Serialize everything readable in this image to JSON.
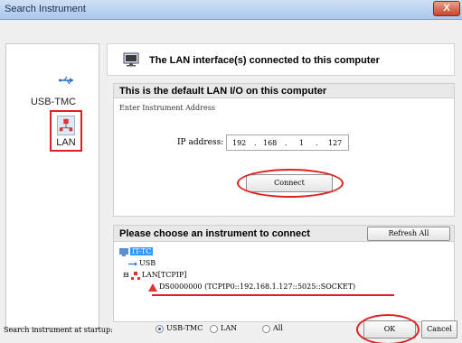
{
  "window": {
    "title": "Search Instrument",
    "close_glyph": "X"
  },
  "sidebar": {
    "items": [
      {
        "label": "USB-TMC",
        "icon": "usb-icon",
        "selected": false
      },
      {
        "label": "LAN",
        "icon": "lan-icon",
        "selected": true
      }
    ]
  },
  "header": {
    "text": "The LAN interface(s) connected to this computer",
    "icon": "monitor-icon"
  },
  "lan_panel": {
    "title": "This is the default LAN I/O on this computer",
    "subtitle": "Enter Instrument Address",
    "ip_label": "IP address:",
    "ip": [
      "192",
      "168",
      "1",
      "127"
    ],
    "connect_label": "Connect"
  },
  "list_panel": {
    "title": "Please choose an instrument to connect",
    "refresh_label": "Refresh All",
    "tree": {
      "root": "IT-TC",
      "usb": "USB",
      "lan": "LAN[TCPIP]",
      "instrument": "DS0000000  (TCPIP0::192.168.1.127::5025::SOCKET)"
    }
  },
  "footer": {
    "startup_label": "Search instrument at startup:",
    "options": [
      {
        "label": "USB-TMC",
        "checked": true
      },
      {
        "label": "LAN",
        "checked": false
      },
      {
        "label": "All",
        "checked": false
      }
    ],
    "ok_label": "OK",
    "cancel_label": "Cancel"
  },
  "colors": {
    "highlight": "#e02020",
    "selection": "#3399ff"
  }
}
